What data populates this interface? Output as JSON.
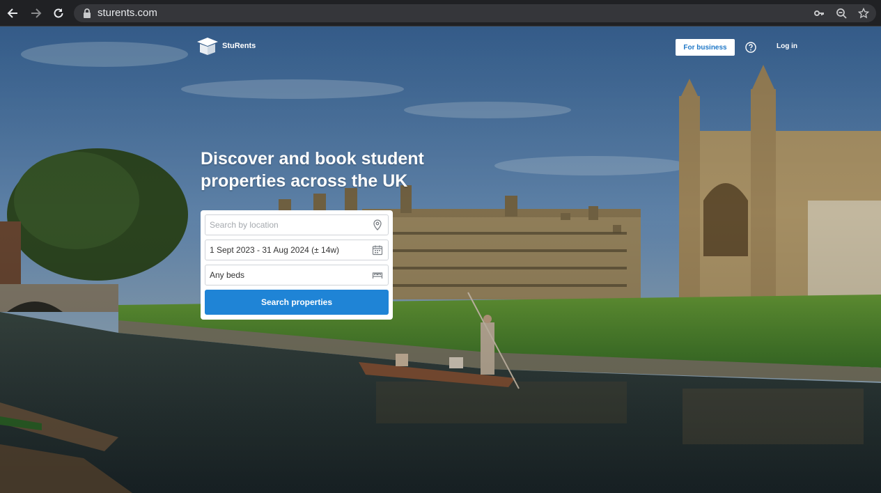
{
  "browser": {
    "url": "sturents.com"
  },
  "site": {
    "logo_text": "StuRents",
    "for_business_label": "For business",
    "login_label": "Log in"
  },
  "hero": {
    "headline": "Discover and book student properties across the UK"
  },
  "search": {
    "location_placeholder": "Search by location",
    "dates_value": "1 Sept 2023 - 31 Aug 2024 (± 14w)",
    "beds_value": "Any beds",
    "submit_label": "Search properties"
  },
  "colors": {
    "brand_blue": "#1f84d6",
    "chrome_bg": "#202124"
  },
  "icons": [
    "back-arrow-icon",
    "forward-arrow-icon",
    "reload-icon",
    "lock-icon",
    "key-icon",
    "zoom-icon",
    "star-icon",
    "help-icon",
    "location-pin-icon",
    "calendar-icon",
    "bed-icon",
    "logo-icon"
  ]
}
